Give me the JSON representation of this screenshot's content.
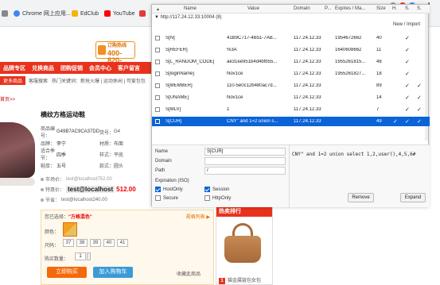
{
  "bookmarks": {
    "items": [
      {
        "label": "apps",
        "color": "#888888"
      },
      {
        "label": "Chrome 网上应用...",
        "color": "#4285f4"
      },
      {
        "label": "EdClub",
        "color": "#f4b400"
      },
      {
        "label": "YouTube",
        "color": "#ff0000"
      },
      {
        "label": "",
        "color": "#e53935"
      }
    ]
  },
  "shop": {
    "phone": {
      "line1": "订购热线",
      "line2": "400-820-"
    },
    "nav": [
      "品牌专区",
      "兑换商品",
      "团购促销",
      "会员中心",
      "客户留言"
    ],
    "subnav": {
      "tag": "更多商品",
      "items": [
        "客服搜索",
        "热门关键词：新抢火爆 | 运动休闲 | 可爱包包"
      ]
    },
    "breadcrumb": "首页>>",
    "product_title": "横纹方格运动鞋",
    "specs": [
      {
        "k": "商品编号：",
        "v": "G49B7AC9CA37DD",
        "k2": "货号：",
        "v2": "G4"
      },
      {
        "k": "品牌：",
        "v": "李宁",
        "k2": "材质：",
        "v2": "布面"
      },
      {
        "k": "适合季节：",
        "v": "四季",
        "k2": "样式：",
        "v2": "平底"
      },
      {
        "k": "鞋厚：",
        "v": "五号",
        "k2": "款式：",
        "v2": "圆头"
      }
    ],
    "prices": {
      "market": {
        "label": "市场价：",
        "value": "test@localhost752.00"
      },
      "member": {
        "label": "特惠价：",
        "highlight": "test@localhost",
        "value": "512.00"
      },
      "save": {
        "label": "节省：",
        "value": "test@localhost240.00"
      }
    },
    "buy": {
      "selected_label": "您已选择：",
      "selected_value": "\"方格混色\"",
      "rule": "规格列表 ▶",
      "color_label": "颜色：",
      "size_label": "尺码：",
      "sizes": [
        "37",
        "38",
        "39",
        "40",
        "41"
      ],
      "qty_label": "购买数量：",
      "qty": "1",
      "buy_now": "立即购买",
      "add_cart": "加入购物车",
      "favorite": "收藏此商品"
    },
    "hot": {
      "title": "热卖排行",
      "item_rank": "1",
      "item_name": "猫金属链包女包"
    }
  },
  "dialog": {
    "columns": [
      "Name",
      "Value",
      "Domain",
      "P...",
      "Expires / Ma...",
      "Size",
      "H.",
      "S.",
      "S."
    ],
    "group": "▼ http://117.24.12.33:10004 (8)",
    "new_import": "New / Import",
    "cookies": [
      {
        "name": "S[N]",
        "value": "41B9C717-4B51-7AB...",
        "domain": "117.24.12.33",
        "expires": "1954672662",
        "size": "40",
        "h": "",
        "s": "✓",
        "s2": ""
      },
      {
        "name": "S[REFER]",
        "value": "%3A",
        "domain": "117.24.12.33",
        "expires": "1640608662",
        "size": "11",
        "h": "",
        "s": "✓",
        "s2": ""
      },
      {
        "name": "S[L_RANDOM_CODE]",
        "value": "ae31ee951b4d4bfb55...",
        "domain": "117.24.12.33",
        "expires": "1955261815...",
        "size": "48",
        "h": "",
        "s": "✓",
        "s2": ""
      },
      {
        "name": "S[loginName]",
        "value": "Nov1ce",
        "domain": "117.24.12.33",
        "expires": "1955261827...",
        "size": "18",
        "h": "",
        "s": "✓",
        "s2": ""
      },
      {
        "name": "S[MEMBER]",
        "value": "110-5e0c12b480ac7d...",
        "domain": "117.24.12.33",
        "expires": "",
        "size": "89",
        "h": "",
        "s": "✓",
        "s2": "✓"
      },
      {
        "name": "S[UNAME]",
        "value": "Nov1ce",
        "domain": "117.24.12.33",
        "expires": "",
        "size": "14",
        "h": "",
        "s": "✓",
        "s2": "✓"
      },
      {
        "name": "S[MLV]",
        "value": "1",
        "domain": "117.24.12.33",
        "expires": "",
        "size": "7",
        "h": "",
        "s": "✓",
        "s2": "✓"
      },
      {
        "name": "S[CUR]",
        "value": "CNY\" and 1=2 union s...",
        "domain": "117.24.12.33",
        "expires": "",
        "size": "49",
        "h": "✓",
        "s": "✓",
        "s2": "✓"
      }
    ],
    "detail": {
      "name_label": "Name",
      "name_value": "S[CUR]",
      "domain_label": "Domain",
      "domain_value": "",
      "path_label": "Path",
      "path_value": "/",
      "expiration_label": "Expiration (ISO)",
      "hostonly_label": "HostOnly",
      "session_label": "Session",
      "secure_label": "Secure",
      "httponly_label": "HttpOnly",
      "value_text": "CNY\" and 1=2 union select 1,2,user(),4,5,6#",
      "remove": "Remove",
      "expand": "Expand"
    }
  },
  "colors": {
    "accent": "#e8321e",
    "selection": "#0a64d8",
    "buy": "#f46a0a",
    "cart": "#3a9bd8"
  }
}
